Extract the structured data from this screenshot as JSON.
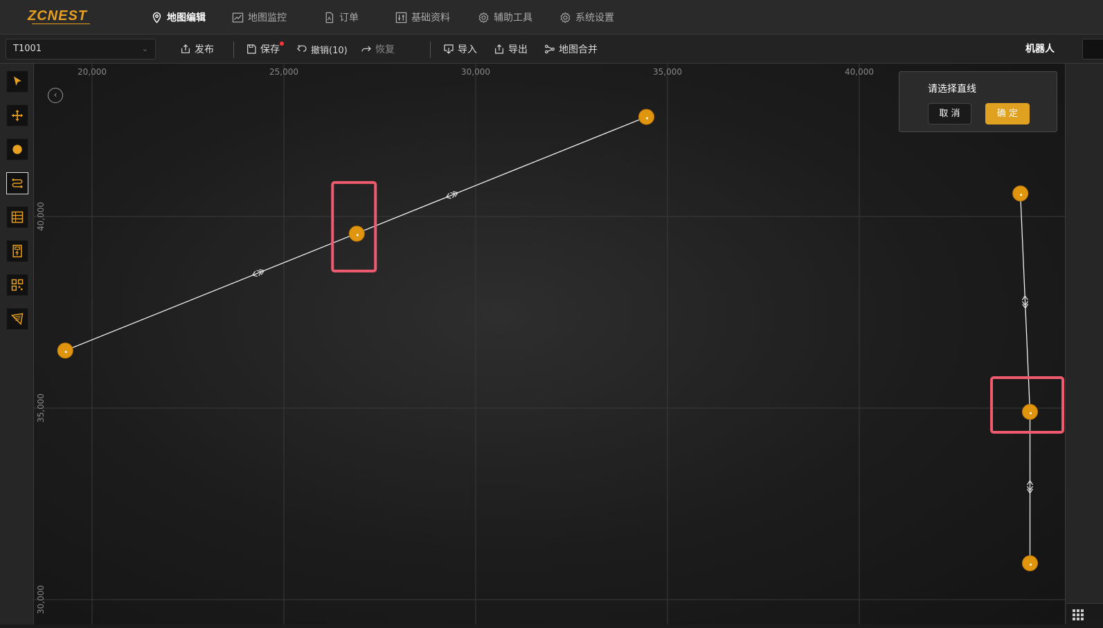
{
  "app": {
    "logo": "ZCNEST"
  },
  "nav": {
    "map_edit": "地图编辑",
    "map_monitor": "地图监控",
    "orders": "订单",
    "basic_data": "基础资料",
    "aux_tools": "辅助工具",
    "system_settings": "系统设置"
  },
  "toolbar": {
    "map_select_value": "T1001",
    "publish": "发布",
    "save": "保存",
    "undo": "撤销(10)",
    "redo": "恢复",
    "import": "导入",
    "export": "导出",
    "merge": "地图合并",
    "robot": "机器人"
  },
  "popup": {
    "title": "请选择直线",
    "cancel": "取 消",
    "ok": "确 定"
  },
  "map": {
    "x_ticks": [
      "20,000",
      "25,000",
      "30,000",
      "35,000",
      "40,000"
    ],
    "y_ticks": [
      "40,000",
      "35,000",
      "30,000"
    ],
    "accent": "#e0950e",
    "highlight": "#f05a6e",
    "nodes": [
      {
        "id": "n1",
        "x": 19300,
        "y": 36500
      },
      {
        "id": "n2",
        "x": 26900,
        "y": 39550
      },
      {
        "id": "n3",
        "x": 34450,
        "y": 42600
      },
      {
        "id": "n4",
        "x": 44200,
        "y": 40600
      },
      {
        "id": "n5",
        "x": 44450,
        "y": 34900
      },
      {
        "id": "n6",
        "x": 44450,
        "y": 30950
      }
    ],
    "edges": [
      {
        "from": "n1",
        "to": "n3"
      },
      {
        "from": "n4",
        "to": "n5"
      },
      {
        "from": "n5",
        "to": "n6"
      }
    ]
  }
}
